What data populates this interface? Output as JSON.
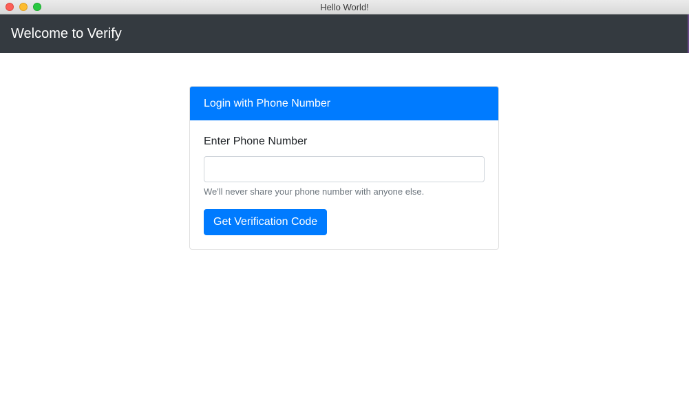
{
  "window": {
    "title": "Hello World!"
  },
  "navbar": {
    "brand": "Welcome to Verify"
  },
  "card": {
    "header": "Login with Phone Number",
    "field_label": "Enter Phone Number",
    "input": {
      "value": "",
      "placeholder": ""
    },
    "help_text": "We'll never share your phone number with anyone else.",
    "button_label": "Get Verification Code"
  },
  "colors": {
    "navbar_bg": "#343a40",
    "primary": "#007bff",
    "help_text": "#6c757d"
  },
  "icons": {
    "close": "close-traffic-light-icon",
    "minimize": "minimize-traffic-light-icon",
    "zoom": "zoom-traffic-light-icon"
  }
}
